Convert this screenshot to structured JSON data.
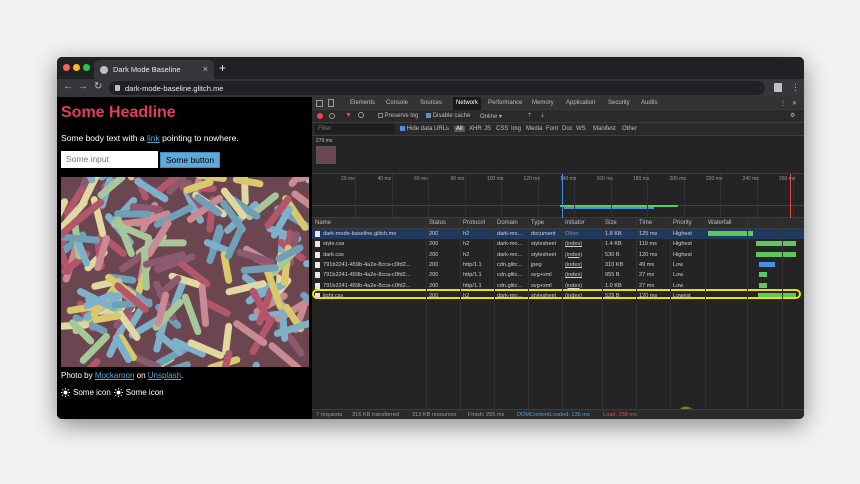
{
  "browser": {
    "tab_title": "Dark Mode Baseline",
    "tab_close": "×",
    "new_tab": "+",
    "url": "dark-mode-baseline.glitch.me",
    "back": "←",
    "forward": "→",
    "reload": "↻",
    "menu": "⋮",
    "colors": {
      "close": "#ff5f57",
      "minimize": "#febc2e",
      "maximize": "#28c840"
    }
  },
  "page": {
    "headline": "Some Headline",
    "body_prefix": "Some body text with a ",
    "body_link": "link",
    "body_suffix": " pointing to nowhere.",
    "input_value": "Some input",
    "button_label": "Some button",
    "credit_prefix": "Photo by ",
    "credit_author": "Mockaroon",
    "credit_middle": " on ",
    "credit_site": "Unsplash",
    "credit_suffix": ".",
    "icon_label_1": "Some icon",
    "icon_label_2": "Some icon"
  },
  "devtools": {
    "tabs": [
      "Elements",
      "Console",
      "Sources",
      "Network",
      "Performance",
      "Memory",
      "Application",
      "Security",
      "Audits"
    ],
    "active_tab": "Network",
    "toolbar": {
      "preserve_log": "Preserve log",
      "disable_cache": "Disable cache",
      "throttle": "Online"
    },
    "filter": {
      "placeholder": "Filter",
      "hide_data_urls": "Hide data URLs",
      "types": [
        "All",
        "XHR",
        "JS",
        "CSS",
        "Img",
        "Media",
        "Font",
        "Doc",
        "WS",
        "Manifest",
        "Other"
      ]
    },
    "screenshot_time": "279 ms",
    "overview_ticks": [
      "20 ms",
      "40 ms",
      "60 ms",
      "80 ms",
      "100 ms",
      "120 ms",
      "140 ms",
      "160 ms",
      "180 ms",
      "200 ms",
      "220 ms",
      "240 ms",
      "260 ms"
    ],
    "columns": [
      "Name",
      "Status",
      "Protocol",
      "Domain",
      "Type",
      "Initiator",
      "Size",
      "Time",
      "Priority",
      "Waterfall"
    ],
    "rows": [
      {
        "name": "dark-mode-baseline.glitch.me",
        "status": "200",
        "protocol": "h2",
        "domain": "dark-mo...",
        "type": "document",
        "initiator": "Other",
        "size": "1.8 KB",
        "time": "125 ms",
        "priority": "Highest",
        "wf_start": 0.0,
        "wf_end": 0.49,
        "color": "#5cc95c"
      },
      {
        "name": "style.css",
        "status": "200",
        "protocol": "h2",
        "domain": "dark-mo...",
        "type": "stylesheet",
        "initiator": "(index)",
        "size": "1.4 KB",
        "time": "119 ms",
        "priority": "Highest",
        "wf_start": 0.52,
        "wf_end": 0.96,
        "color": "#5cc95c"
      },
      {
        "name": "dark.css",
        "status": "200",
        "protocol": "h2",
        "domain": "dark-mo...",
        "type": "stylesheet",
        "initiator": "(index)",
        "size": "530 B",
        "time": "120 ms",
        "priority": "Highest",
        "wf_start": 0.52,
        "wf_end": 0.96,
        "color": "#5cc95c"
      },
      {
        "name": "791b2241-459b-4a2e-8cca-c0fd2...",
        "status": "200",
        "protocol": "http/1.1",
        "domain": "cdn.glitc...",
        "type": "jpeg",
        "initiator": "(index)",
        "size": "310 KB",
        "time": "49 ms",
        "priority": "Low",
        "wf_start": 0.55,
        "wf_end": 0.73,
        "color": "#4a90e2"
      },
      {
        "name": "791b2241-459b-4a2e-8cca-c0fd2...",
        "status": "200",
        "protocol": "http/1.1",
        "domain": "cdn.glitc...",
        "type": "svg+xml",
        "initiator": "(index)",
        "size": "955 B",
        "time": "27 ms",
        "priority": "Low",
        "wf_start": 0.55,
        "wf_end": 0.64,
        "color": "#5cc95c"
      },
      {
        "name": "791b2241-459b-4a2e-8cca-c0fd2...",
        "status": "200",
        "protocol": "http/1.1",
        "domain": "cdn.glitc...",
        "type": "svg+xml",
        "initiator": "(index)",
        "size": "1.0 KB",
        "time": "27 ms",
        "priority": "Low",
        "wf_start": 0.55,
        "wf_end": 0.64,
        "color": "#5cc95c"
      },
      {
        "name": "light.css",
        "status": "200",
        "protocol": "h2",
        "domain": "dark-mo...",
        "type": "stylesheet",
        "initiator": "(index)",
        "size": "529 B",
        "time": "120 ms",
        "priority": "Lowest",
        "wf_start": 0.54,
        "wf_end": 0.96,
        "color": "#5cc95c"
      }
    ],
    "statusbar": {
      "requests": "7 requests",
      "transferred": "316 KB transferred",
      "resources": "313 KB resources",
      "finish": "Finish: 255 ms",
      "dcl": "DOMContentLoaded: 136 ms",
      "load": "Load: 258 ms"
    }
  }
}
